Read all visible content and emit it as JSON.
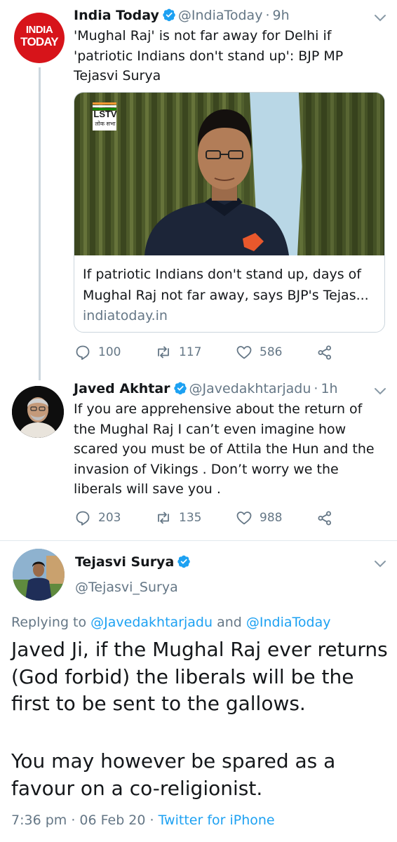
{
  "tweet1": {
    "avatar_text_line1": "INDIA",
    "avatar_text_line2": "TODAY",
    "display_name": "India Today",
    "handle": "@IndiaToday",
    "separator": "·",
    "time": "9h",
    "text": "'Mughal Raj' is not far away for Delhi if 'patriotic Indians don't stand up': BJP MP Tejasvi Surya",
    "card": {
      "logo_text": "LSTV",
      "logo_subtext": "लोक सभा",
      "title": "If patriotic Indians don't stand up, days of Mughal Raj not far away, says BJP's Tejas...",
      "domain": "indiatoday.in"
    },
    "replies": "100",
    "retweets": "117",
    "likes": "586"
  },
  "tweet2": {
    "display_name": "Javed Akhtar",
    "handle": "@Javedakhtarjadu",
    "separator": "·",
    "time": "1h",
    "text": "If you are apprehensive about the return of the Mughal Raj I can’t even imagine how scared you must be of Attila the Hun and  the invasion of Vikings . Don’t worry we the liberals will save you .",
    "replies": "203",
    "retweets": "135",
    "likes": "988"
  },
  "tweet3": {
    "display_name": "Tejasvi Surya",
    "handle": "@Tejasvi_Surya",
    "replying_prefix": "Replying to",
    "reply_handle1": "@Javedakhtarjadu",
    "reply_and": "and",
    "reply_handle2": "@IndiaToday",
    "text_para1": "Javed Ji, if the Mughal Raj ever returns (God forbid) the liberals will be the first to be sent to the gallows.",
    "text_para2": "You may however be spared as a favour on a co-religionist.",
    "timestamp": "7:36 pm · 06 Feb 20 ·",
    "source": "Twitter for iPhone"
  },
  "colors": {
    "accent": "#1da1f2",
    "secondary_text": "#657786",
    "primary_text": "#14171a",
    "brand_red": "#d7141a"
  },
  "icons": [
    "verified-badge-icon",
    "chevron-down-icon",
    "reply-icon",
    "retweet-icon",
    "like-icon",
    "share-icon"
  ]
}
